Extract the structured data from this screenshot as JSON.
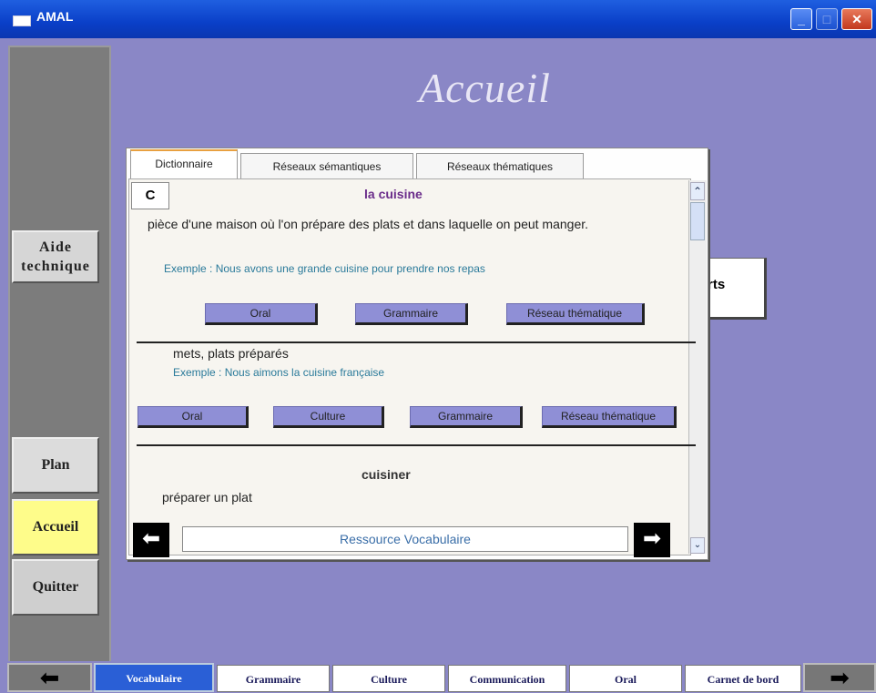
{
  "window": {
    "title": "AMAL"
  },
  "page": {
    "title": "Accueil"
  },
  "sidebar": {
    "aide_line1": "Aide",
    "aide_line2": "technique",
    "plan": "Plan",
    "accueil": "Accueil",
    "quitter": "Quitter"
  },
  "background_button": {
    "label": "rts"
  },
  "dialog": {
    "tabs": [
      "Dictionnaire",
      "Réseaux sémantiques",
      "Réseaux thématiques"
    ],
    "letter": "C",
    "entries": [
      {
        "word": "la cuisine",
        "definition": "pièce d'une maison où l'on prépare des plats et dans laquelle on peut manger.",
        "example": "Exemple : Nous avons une grande cuisine pour prendre nos repas",
        "buttons": [
          "Oral",
          "Grammaire",
          "Réseau thématique"
        ]
      },
      {
        "definition": "mets, plats préparés",
        "example": "Exemple : Nous aimons la cuisine française",
        "buttons": [
          "Oral",
          "Culture",
          "Grammaire",
          "Réseau thématique"
        ]
      },
      {
        "word": "cuisiner",
        "definition": "préparer un plat"
      }
    ],
    "resource_field": "Ressource Vocabulaire"
  },
  "bottom_tabs": [
    "Vocabulaire",
    "Grammaire",
    "Culture",
    "Communication",
    "Oral",
    "Carnet de bord"
  ],
  "icons": {
    "prev": "arrow-left-icon",
    "next": "arrow-right-icon"
  },
  "colors": {
    "background": "#8a87c6",
    "accent_yellow": "#fefc8a",
    "button_purple": "#8f8fd6",
    "active_tab": "#2a5fd6"
  }
}
